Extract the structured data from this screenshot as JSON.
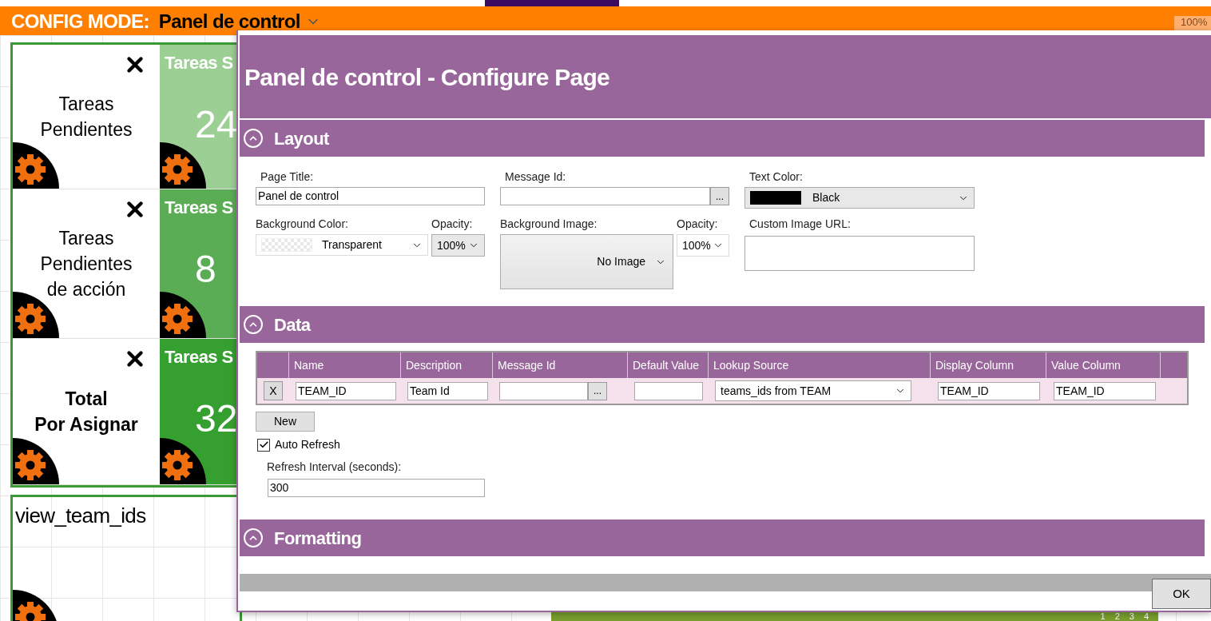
{
  "config_bar": {
    "label": "CONFIG MODE:",
    "page": "Panel de control",
    "zoom": "100%"
  },
  "tiles": [
    {
      "label": "Tareas\nPendientes",
      "bold": false,
      "value_title": "Tareas S",
      "value": "24",
      "color": "#9ccf93"
    },
    {
      "label": "Tareas\nPendientes\nde acción",
      "bold": false,
      "value_title": "Tareas S",
      "value": "8",
      "color": "#5aad55"
    },
    {
      "label": "Total\nPor Asignar",
      "bold": true,
      "value_title": "Tareas S",
      "value": "32",
      "color": "#35a02f"
    }
  ],
  "view_tile": {
    "title": "view_team_ids"
  },
  "pager": [
    "1",
    "2",
    "3",
    "4"
  ],
  "dialog": {
    "title": "Panel de control - Configure Page",
    "layout": {
      "header": "Layout",
      "expanded": true,
      "page_title": {
        "label": "Page Title:",
        "value": "Panel de control"
      },
      "message_id": {
        "label": "Message Id:",
        "button": "..."
      },
      "text_color": {
        "label": "Text Color:",
        "value": "Black",
        "color": "#000000"
      },
      "background_color": {
        "label": "Background Color:",
        "value": "Transparent"
      },
      "opacity": {
        "label": "Opacity:",
        "value": "100%"
      },
      "background_image": {
        "label": "Background Image:",
        "value": "No Image"
      },
      "image_opacity": {
        "label": "Opacity:",
        "value": "100%"
      },
      "custom_image_url": {
        "label": "Custom Image URL:"
      }
    },
    "data": {
      "header": "Data",
      "expanded": true,
      "columns": [
        "Name",
        "Description",
        "Message Id",
        "Default Value",
        "Lookup Source",
        "Display Column",
        "Value Column"
      ],
      "rows": [
        {
          "remove": "X",
          "name": "TEAM_ID",
          "description": "Team Id",
          "message_id_button": "...",
          "lookup_source": "teams_ids from TEAM",
          "display_column": "TEAM_ID",
          "value_column": "TEAM_ID"
        }
      ],
      "new_button": "New",
      "auto_refresh": {
        "label": "Auto Refresh",
        "checked": true
      },
      "refresh_interval": {
        "label": "Refresh Interval (seconds):",
        "value": "300"
      }
    },
    "formatting": {
      "header": "Formatting",
      "expanded": true
    },
    "ok": "OK"
  }
}
